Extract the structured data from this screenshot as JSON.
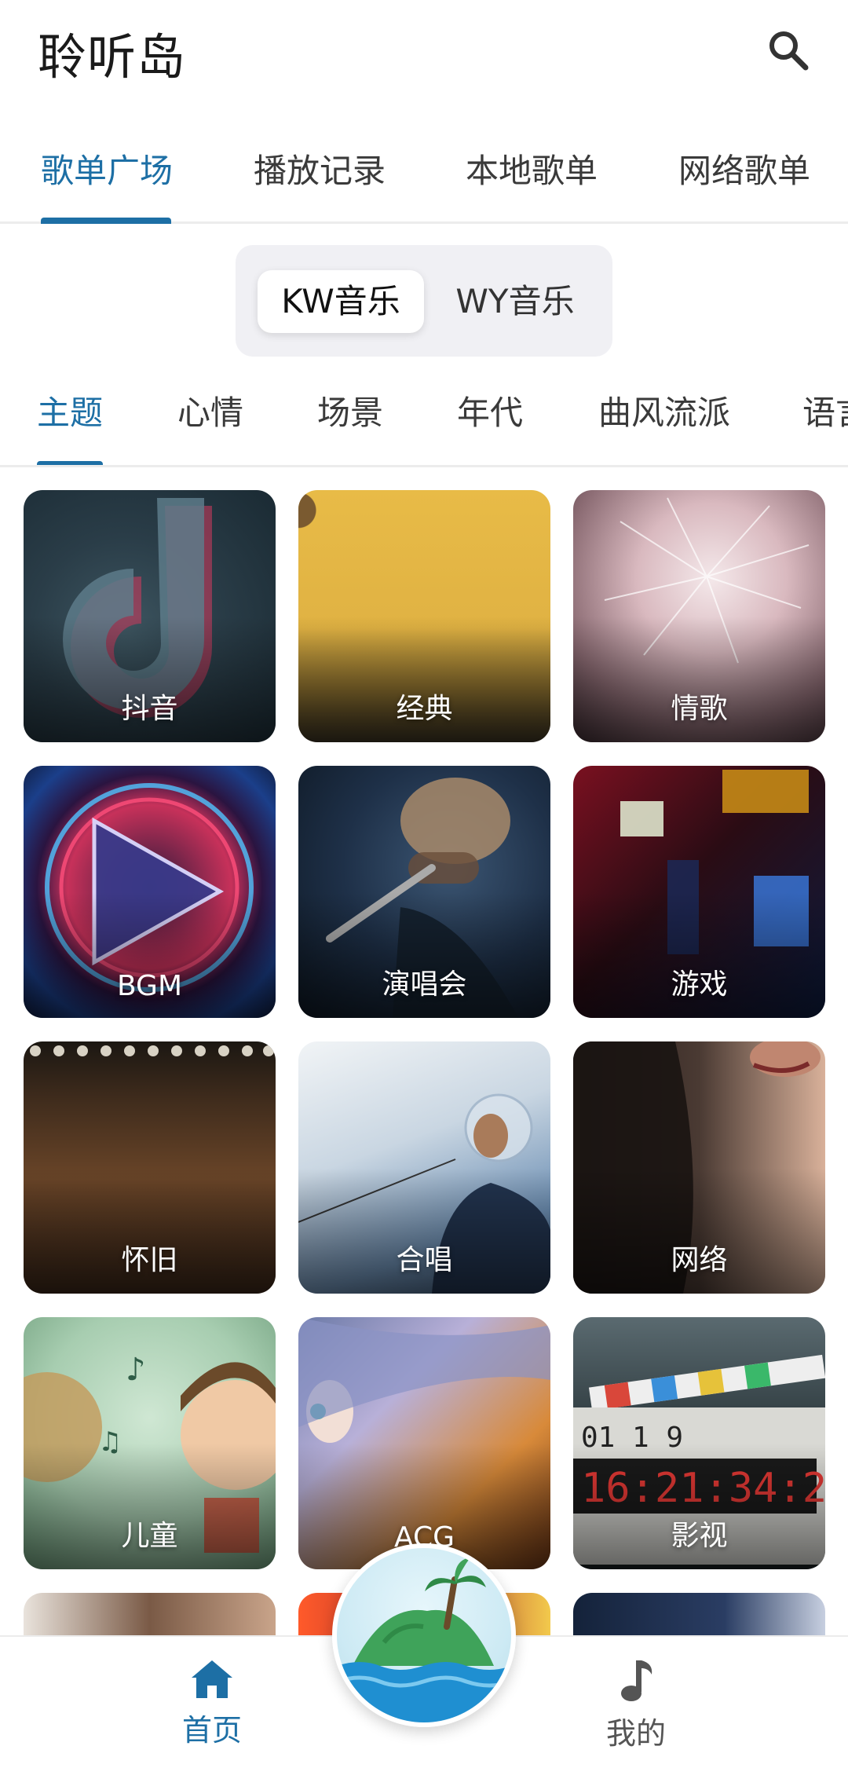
{
  "app": {
    "title": "聆听岛"
  },
  "header": {
    "search_icon": "search-icon"
  },
  "main_tabs": [
    {
      "label": "歌单广场",
      "active": true
    },
    {
      "label": "播放记录",
      "active": false
    },
    {
      "label": "本地歌单",
      "active": false
    },
    {
      "label": "网络歌单",
      "active": false
    }
  ],
  "source_toggle": [
    {
      "label": "KW音乐",
      "active": true
    },
    {
      "label": "WY音乐",
      "active": false
    }
  ],
  "category_tabs": [
    {
      "label": "主题",
      "active": true
    },
    {
      "label": "心情",
      "active": false
    },
    {
      "label": "场景",
      "active": false
    },
    {
      "label": "年代",
      "active": false
    },
    {
      "label": "曲风流派",
      "active": false
    },
    {
      "label": "语言",
      "active": false
    }
  ],
  "playlists": [
    {
      "label": "抖音"
    },
    {
      "label": "经典"
    },
    {
      "label": "情歌"
    },
    {
      "label": "BGM"
    },
    {
      "label": "演唱会"
    },
    {
      "label": "游戏"
    },
    {
      "label": "怀旧"
    },
    {
      "label": "合唱"
    },
    {
      "label": "网络"
    },
    {
      "label": "儿童"
    },
    {
      "label": "ACG"
    },
    {
      "label": "影视"
    },
    {
      "label": ""
    },
    {
      "label": ""
    },
    {
      "label": ""
    }
  ],
  "bottom_nav": [
    {
      "label": "首页",
      "icon": "home-icon",
      "active": true
    },
    {
      "label": "我的",
      "icon": "music-note-icon",
      "active": false
    }
  ],
  "fab": {
    "icon": "island-logo-icon"
  },
  "colors": {
    "accent": "#1d6fa5",
    "divider": "#ececec",
    "toggle_bg": "#f0f0f4"
  }
}
